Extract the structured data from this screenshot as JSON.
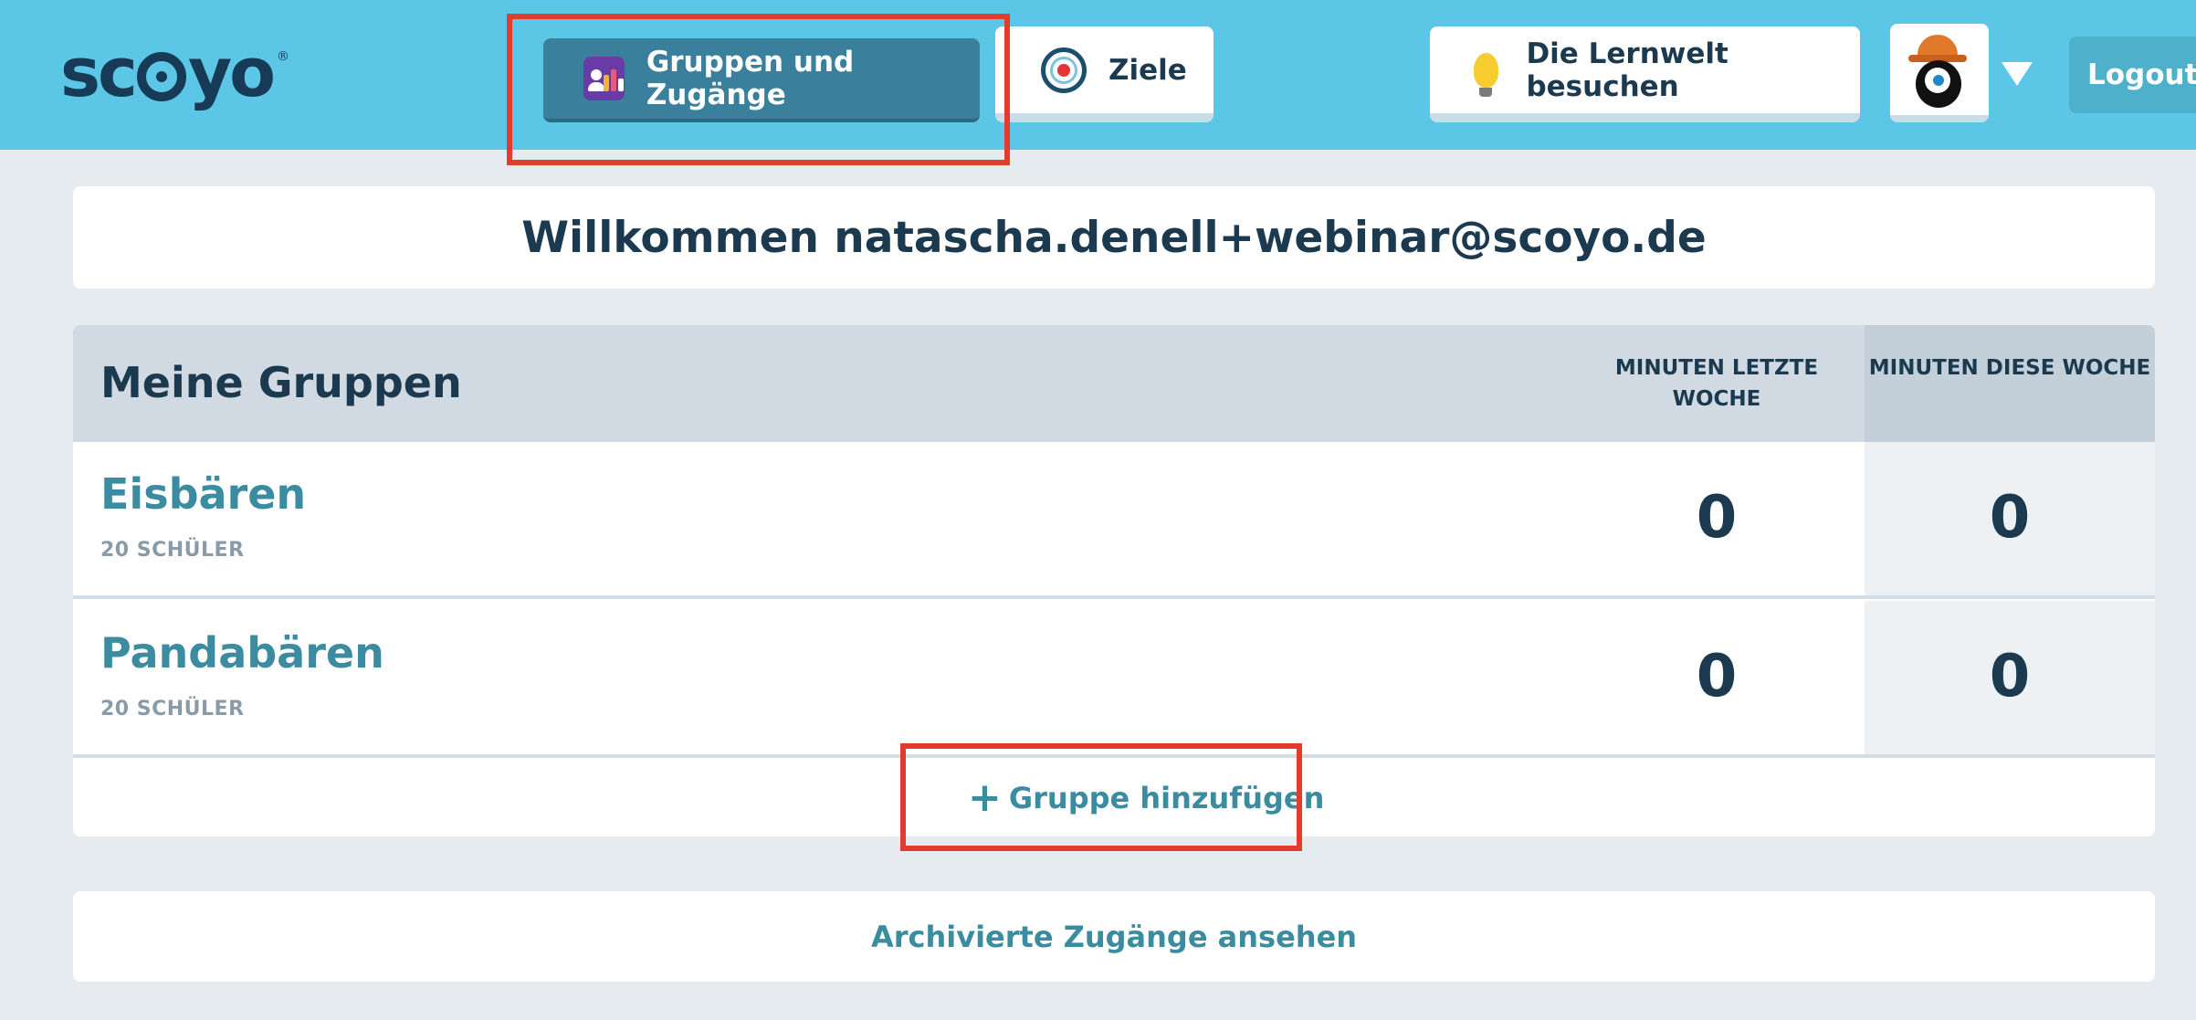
{
  "header": {
    "logo_text": "scoyo",
    "logo_mark": "®",
    "nav": {
      "groups_label": "Gruppen und Zugänge",
      "goals_label": "Ziele",
      "learn_label": "Die Lernwelt besuchen"
    },
    "logout_label": "Logout"
  },
  "welcome": {
    "text": "Willkommen natascha.denell+webinar@scoyo.de"
  },
  "groups_table": {
    "title": "Meine Gruppen",
    "col_last_week": "MINUTEN LETZTE WOCHE",
    "col_this_week": "MINUTEN DIESE WOCHE",
    "rows": [
      {
        "name": "Eisbären",
        "students": "20 SCHÜLER",
        "minutes_last_week": "0",
        "minutes_this_week": "0"
      },
      {
        "name": "Pandabären",
        "students": "20 SCHÜLER",
        "minutes_last_week": "0",
        "minutes_this_week": "0"
      }
    ],
    "add_group_label": "Gruppe hinzufügen"
  },
  "archive_link_label": "Archivierte Zugänge ansehen",
  "colors": {
    "header_bg": "#5cc6e6",
    "active_nav": "#3a7f9c",
    "highlight": "#e43c2c",
    "link": "#3b8ca0",
    "text_dark": "#1c3a4f"
  },
  "icons": [
    "groups-icon",
    "target-icon",
    "lightbulb-icon",
    "avatar-monster-icon",
    "chevron-down-icon",
    "plus-icon"
  ]
}
